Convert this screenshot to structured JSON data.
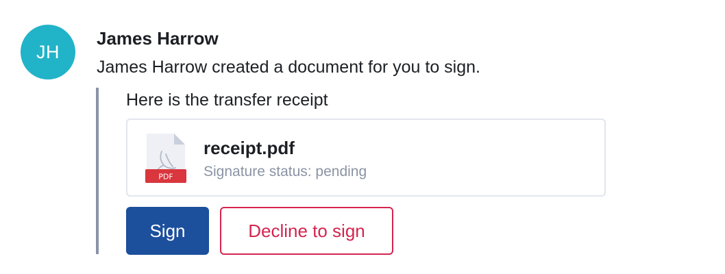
{
  "sender": {
    "initials": "JH",
    "name": "James Harrow",
    "avatar_color": "#21b3c8"
  },
  "message": {
    "text": "James Harrow created a document for you to sign."
  },
  "document": {
    "note": "Here is the transfer receipt",
    "file_name": "receipt.pdf",
    "file_type_label": "PDF",
    "status_text": "Signature status: pending",
    "icon": "pdf-file-icon"
  },
  "actions": {
    "sign_label": "Sign",
    "decline_label": "Decline to sign"
  },
  "colors": {
    "primary": "#1c4f9c",
    "danger": "#d4244f",
    "quote_bar": "#8a93a6",
    "pdf_badge": "#d9363e"
  }
}
